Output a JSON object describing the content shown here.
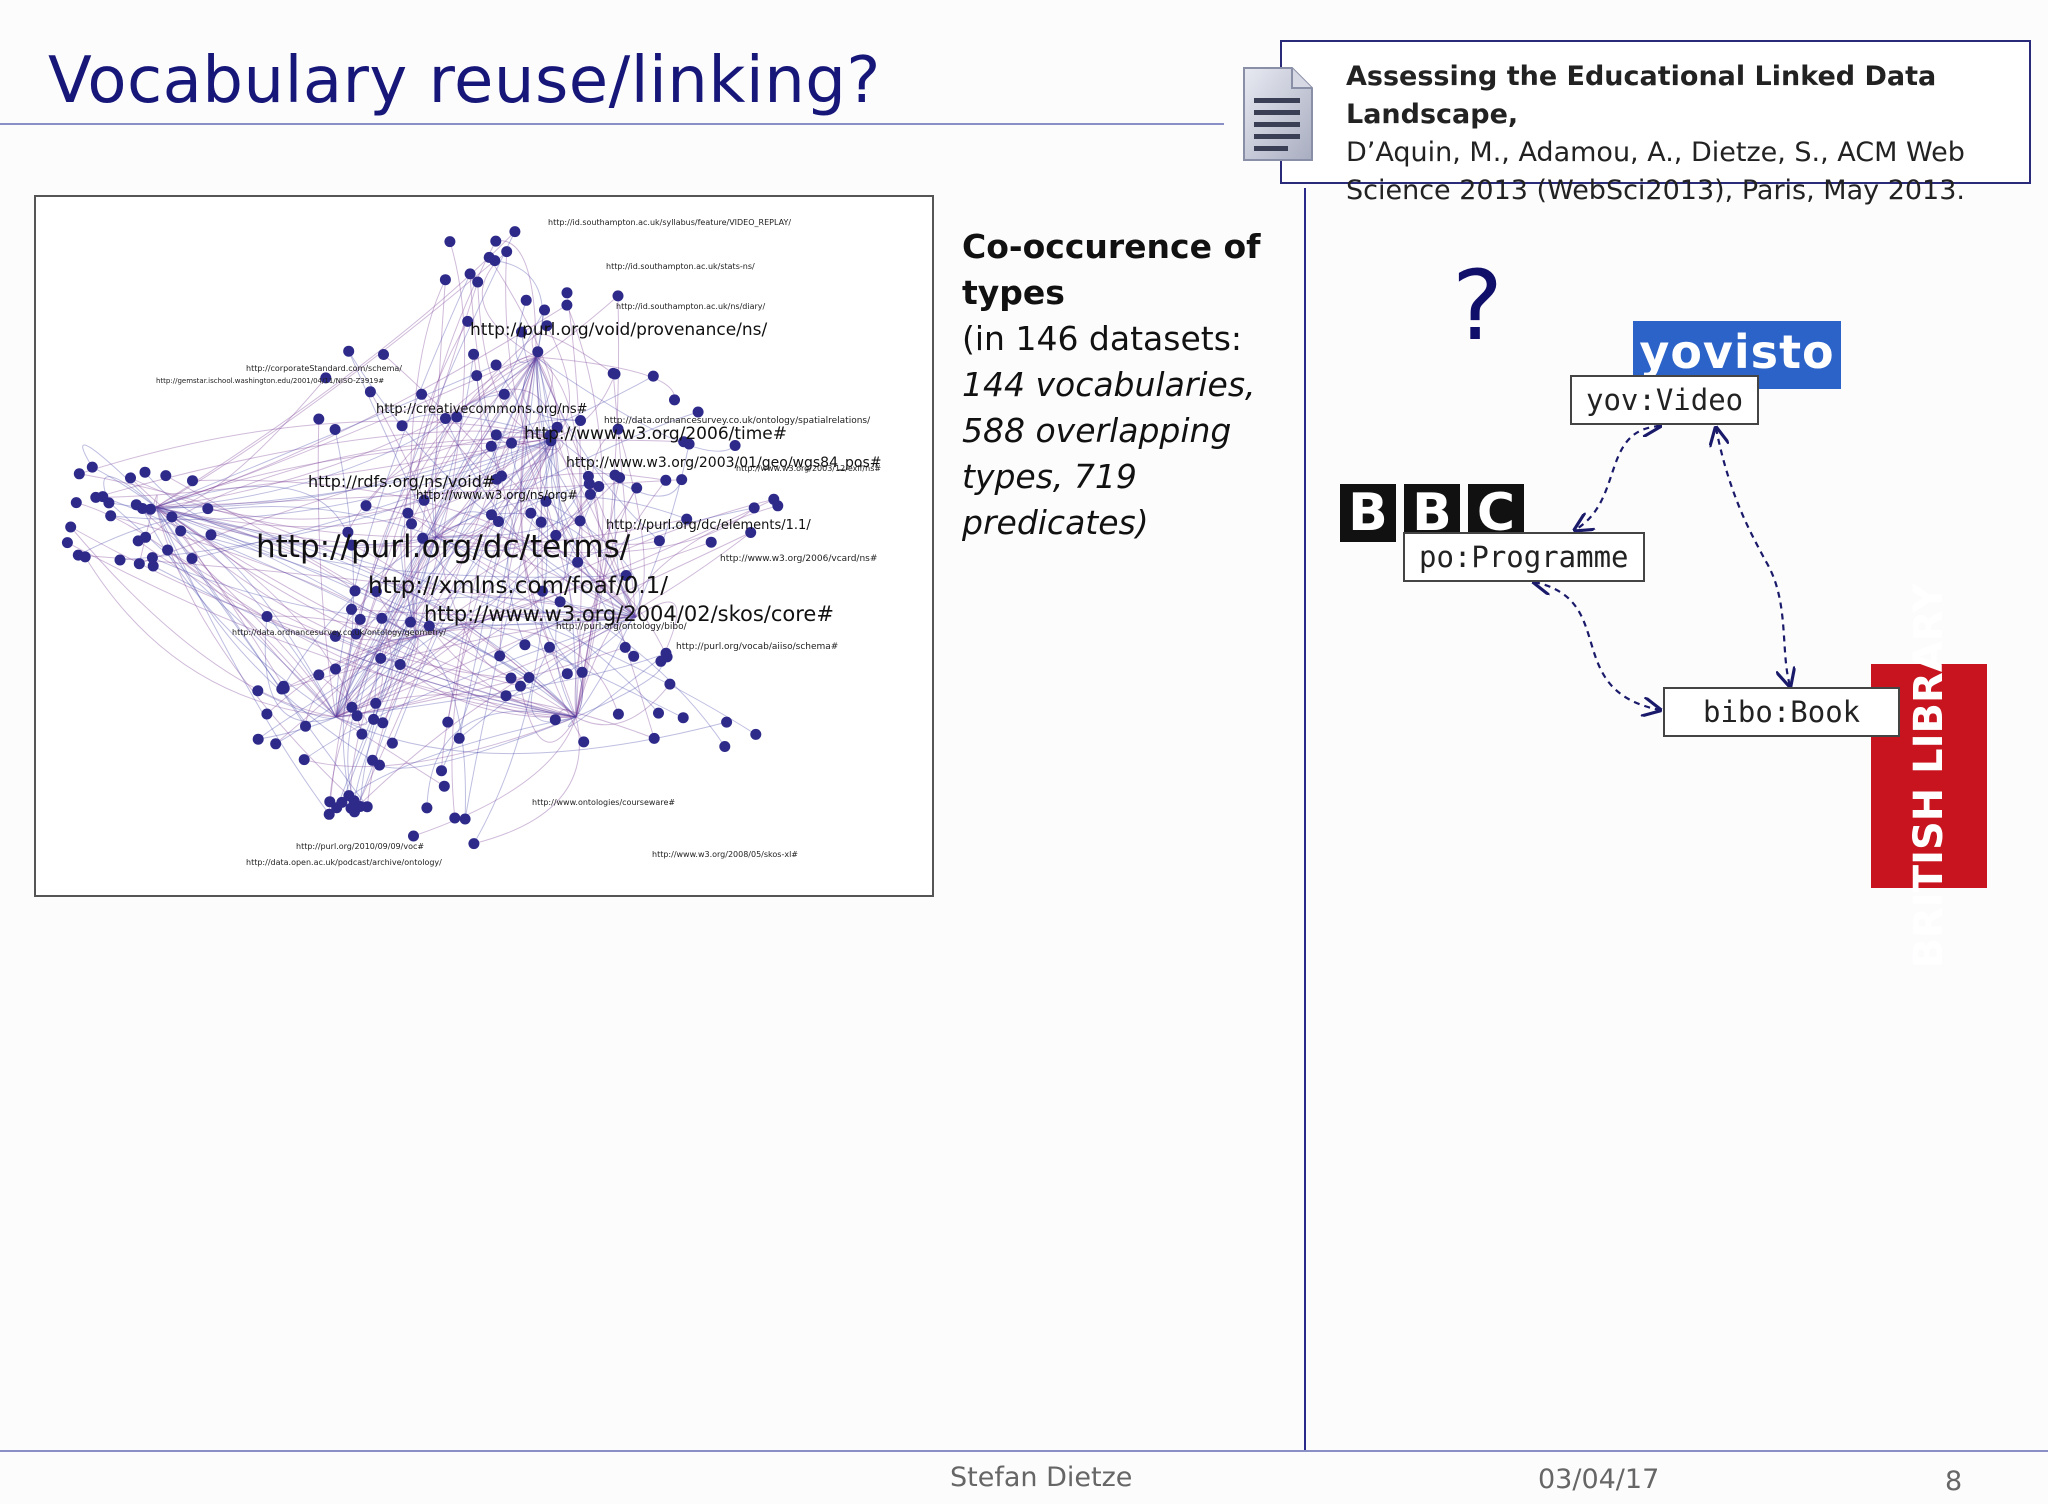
{
  "slide": {
    "title": "Vocabulary reuse/linking?",
    "reference": {
      "title": "Assessing the Educational Linked Data Landscape,",
      "body": "D’Aquin, M., Adamou, A., Dietze, S., ACM Web Science 2013 (WebSci2013), Paris, May 2013."
    },
    "cooccurrence": {
      "heading": "Co-occurence of types",
      "line1": "(in 146 datasets:",
      "line2": "144 vocabularies, 588 overlapping types, 719 predicates)"
    },
    "question_mark": "?",
    "logos": {
      "yovisto": "yovisto",
      "bbc": [
        "B",
        "B",
        "C"
      ],
      "british_library": "BRITISH LIBRARY"
    },
    "terms": {
      "yov": "yov:Video",
      "po": "po:Programme",
      "bibo": "bibo:Book"
    },
    "graph_labels": {
      "dcterms": "http://purl.org/dc/terms/",
      "foaf": "http://xmlns.com/foaf/0.1/",
      "skos": "http://www.w3.org/2004/02/skos/core#",
      "void": "http://rdfs.org/ns/void#",
      "prov": "http://purl.org/void/provenance/ns/",
      "time": "http://www.w3.org/2006/time#",
      "geo": "http://www.w3.org/2003/01/geo/wgs84_pos#",
      "elements": "http://purl.org/dc/elements/1.1/",
      "org": "http://www.w3.org/ns/org#",
      "cc": "http://creativecommons.org/ns#",
      "vcard": "http://www.w3.org/2006/vcard/ns#",
      "aiiso": "http://purl.org/vocab/aiiso/schema#",
      "bibo": "http://purl.org/ontology/bibo/",
      "stats": "http://id.southampton.ac.uk/stats-ns/",
      "diary": "http://id.southampton.ac.uk/ns/diary/",
      "spatial": "http://data.ordnancesurvey.co.uk/ontology/spatialrelations/",
      "replay": "http://id.southampton.ac.uk/syllabus/feature/VIDEO_REPLAY/",
      "courseware": "http://www.ontologies/courseware#",
      "skosxl": "http://www.w3.org/2008/05/skos-xl#",
      "voc": "http://purl.org/2010/09/09/voc#",
      "archive": "http://data.open.ac.uk/podcast/archive/ontology/",
      "nisoz": "http://gemstar.ischool.washington.edu/2001/04/11/NISO-Z3919#",
      "schema": "http://corporateStandard.com/schema/",
      "exif": "http://www.w3.org/2003/12/exif/ns#",
      "geoont": "http://data.ordnancesurvey.co.uk/ontology/geometry/"
    },
    "footer": {
      "author": "Stefan Dietze",
      "date": "03/04/17",
      "page": "8"
    }
  }
}
